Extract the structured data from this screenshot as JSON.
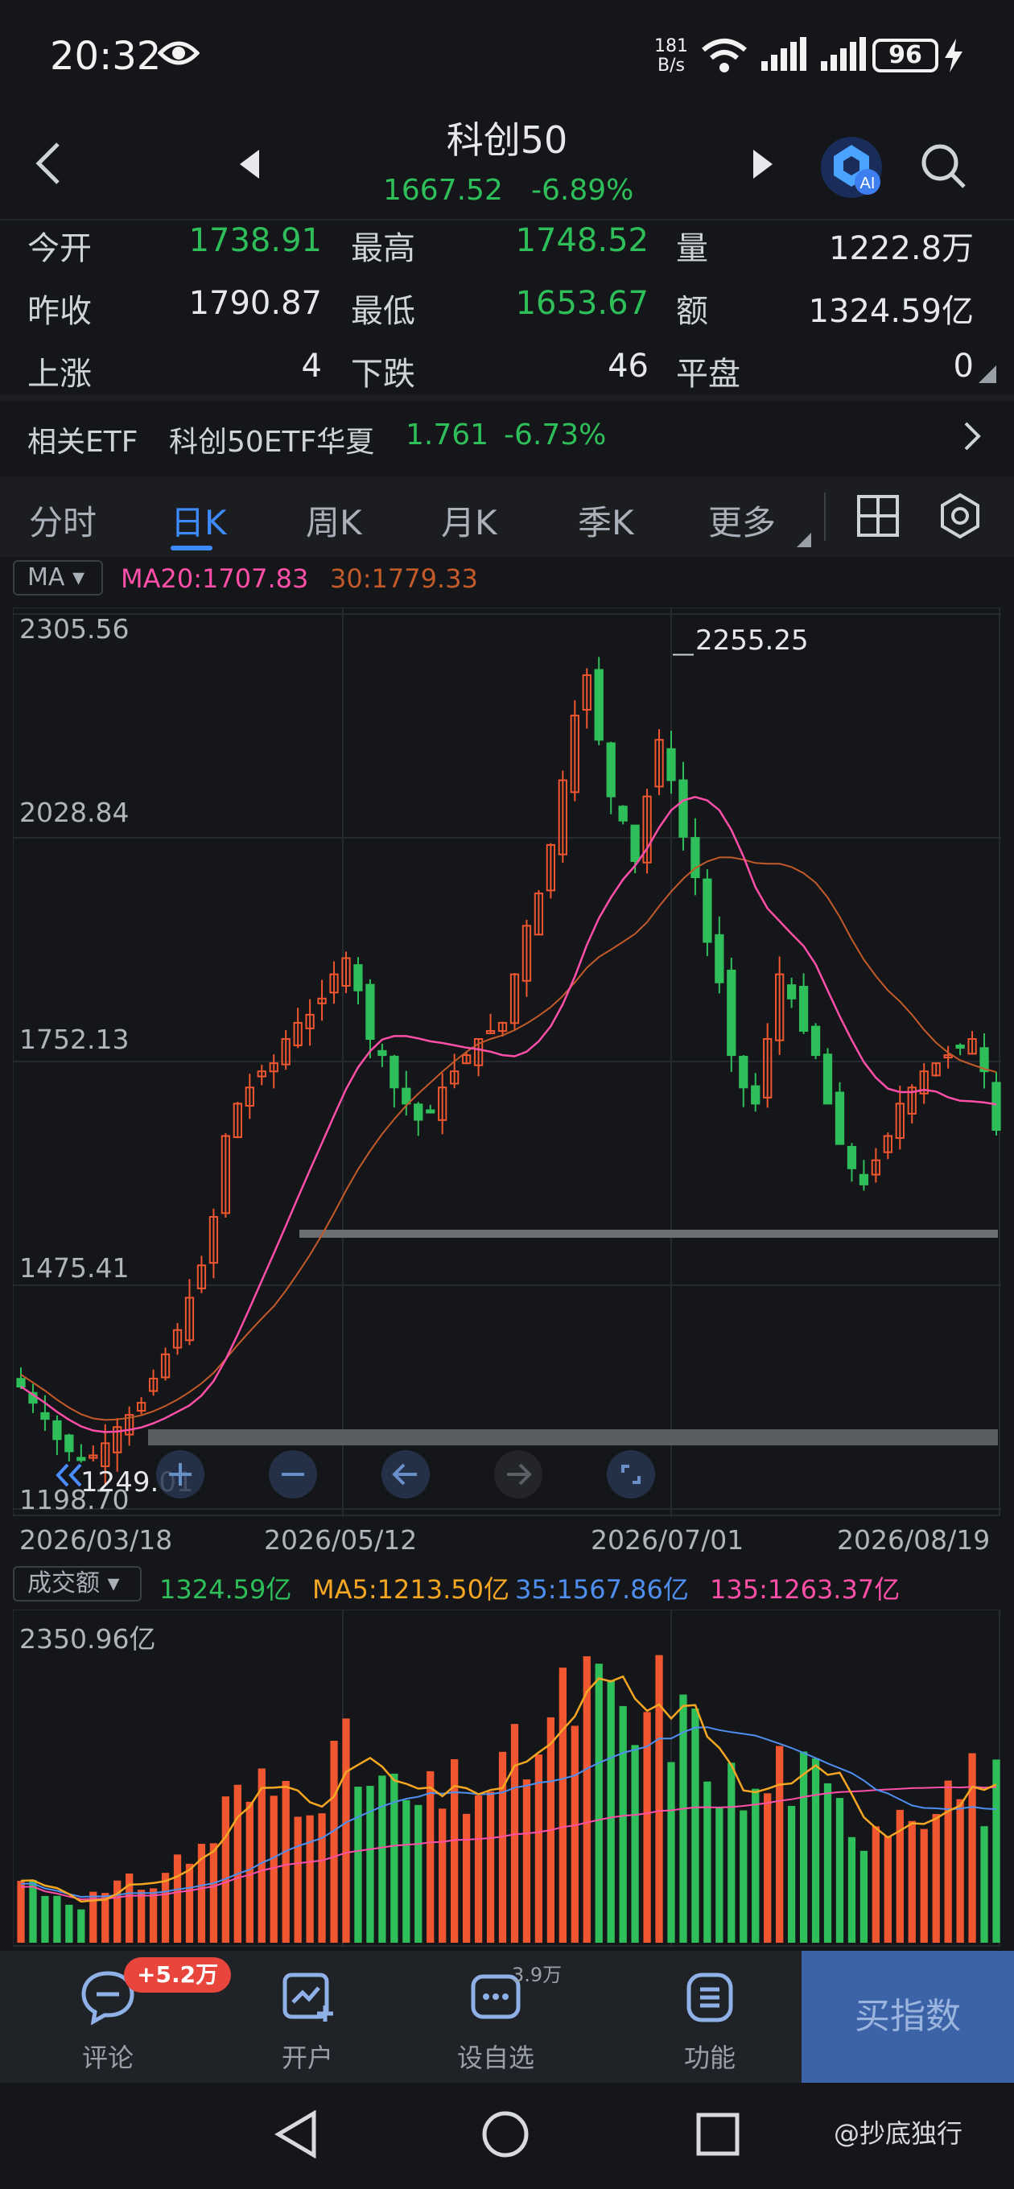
{
  "status": {
    "time": "20:32",
    "net_speed_top": "181",
    "net_speed_bottom": "B/s",
    "battery": "96"
  },
  "header": {
    "title": "科创50",
    "price": "1667.52",
    "change_pct": "-6.89%",
    "ai_badge": "AI"
  },
  "quote": {
    "rows": [
      {
        "l1": "今开",
        "v1": "1738.91",
        "l2": "最高",
        "v2": "1748.52",
        "l3": "量",
        "v3": "1222.8万"
      },
      {
        "l1": "昨收",
        "v1": "1790.87",
        "l2": "最低",
        "v2": "1653.67",
        "l3": "额",
        "v3": "1324.59亿"
      },
      {
        "l1": "上涨",
        "v1": "4",
        "l2": "下跌",
        "v2": "46",
        "l3": "平盘",
        "v3": "0"
      }
    ]
  },
  "etf": {
    "label": "相关ETF",
    "name": "科创50ETF华夏",
    "price": "1.761",
    "pct": "-6.73%"
  },
  "tabs": [
    {
      "label": "分时"
    },
    {
      "label": "日K"
    },
    {
      "label": "周K"
    },
    {
      "label": "月K"
    },
    {
      "label": "季K"
    },
    {
      "label": "更多"
    }
  ],
  "ma_legend": {
    "selector": "MA",
    "ma20": "MA20:1707.83",
    "ma30": "30:1779.33"
  },
  "kline": {
    "y_labels": [
      "2305.56",
      "2028.84",
      "1752.13",
      "1475.41",
      "1198.70"
    ],
    "high_annotation": "2255.25",
    "low_annotation": "1249.01",
    "dates": [
      "2026/03/18",
      "2026/05/12",
      "2026/07/01",
      "2026/08/19"
    ]
  },
  "volume": {
    "selector": "成交额",
    "current": "1324.59亿",
    "ma5": "MA5:1213.50亿",
    "ma35": "35:1567.86亿",
    "ma135": "135:1263.37亿",
    "top_label": "2350.96亿"
  },
  "bottom_bar": {
    "comment": "评论",
    "comment_badge": "+5.2万",
    "open": "开户",
    "watch": "设自选",
    "watch_count": "3.9万",
    "func": "功能",
    "buy": "买指数"
  },
  "watermark": "@抄底独行",
  "chart_data": {
    "type": "candlestick",
    "x_range": [
      "2026/03/18",
      "2026/08/26"
    ],
    "date_ticks": [
      "2026/03/18",
      "2026/05/12",
      "2026/07/01",
      "2026/08/19"
    ],
    "ylim": [
      1198.7,
      2305.56
    ],
    "y_ticks": [
      2305.56,
      2028.84,
      1752.13,
      1475.41,
      1198.7
    ],
    "max_high": 2255.25,
    "min_low": 1249.01,
    "close_path": [
      1350,
      1330,
      1310,
      1285,
      1270,
      1260,
      1265,
      1280,
      1300,
      1315,
      1330,
      1360,
      1390,
      1420,
      1460,
      1500,
      1560,
      1660,
      1700,
      1720,
      1740,
      1750,
      1780,
      1800,
      1810,
      1830,
      1860,
      1880,
      1840,
      1780,
      1760,
      1720,
      1700,
      1680,
      1690,
      1720,
      1740,
      1760,
      1780,
      1790,
      1800,
      1860,
      1920,
      1960,
      2020,
      2100,
      2180,
      2230,
      2150,
      2080,
      2050,
      2000,
      2080,
      2150,
      2100,
      2030,
      1980,
      1900,
      1850,
      1760,
      1720,
      1700,
      1780,
      1860,
      1830,
      1790,
      1760,
      1700,
      1650,
      1620,
      1600,
      1630,
      1660,
      1700,
      1720,
      1740,
      1750,
      1760,
      1770,
      1780,
      1740,
      1667.52
    ],
    "ma_current": {
      "MA20": 1707.83,
      "MA30": 1779.33
    },
    "volume": {
      "unit": "亿",
      "max": 2350.96,
      "current": 1324.59,
      "MA5": 1213.5,
      "MA35": 1567.86,
      "MA135": 1263.37
    }
  }
}
